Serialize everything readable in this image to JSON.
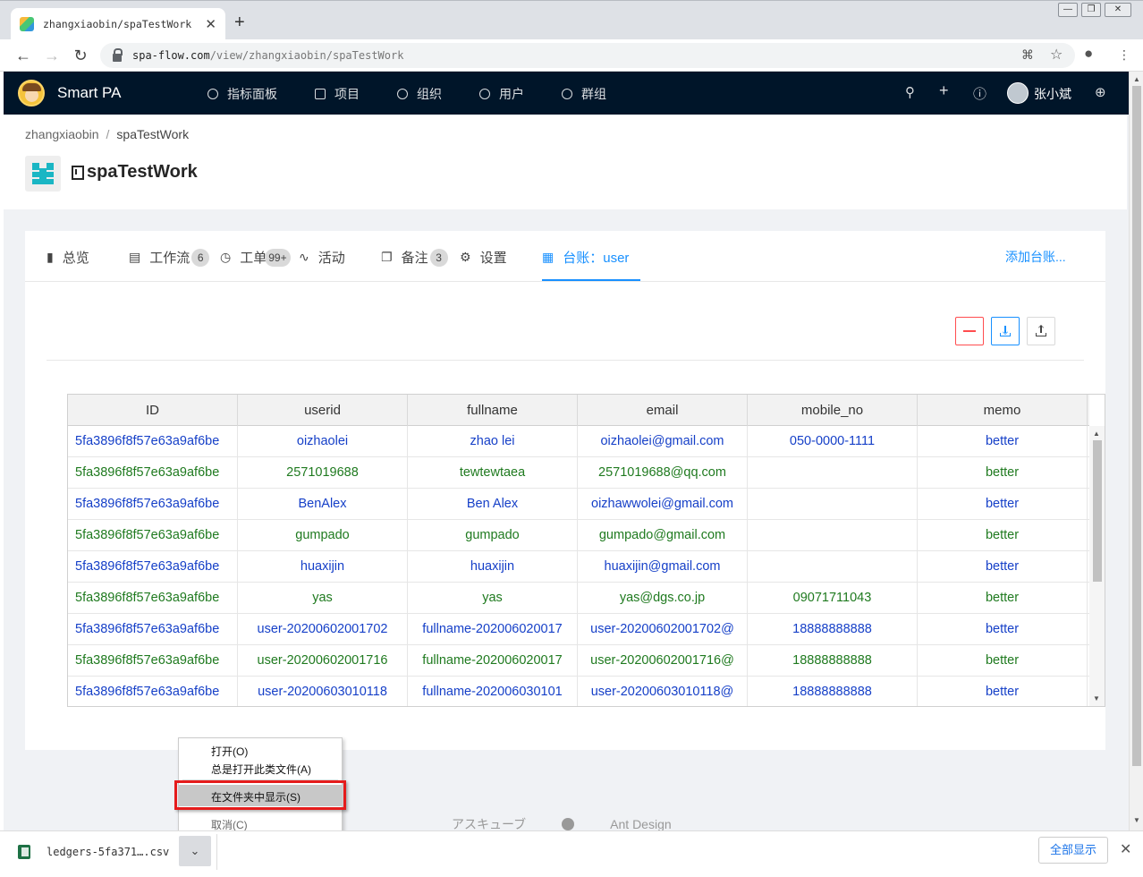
{
  "browser": {
    "tab_title": "zhangxiaobin/spaTestWork",
    "url_host": "spa-flow.com",
    "url_path": "/view/zhangxiaobin/spaTestWork"
  },
  "app": {
    "brand": "Smart PA",
    "menu": [
      "指标面板",
      "项目",
      "组织",
      "用户",
      "群组"
    ],
    "user_name": "张小斌"
  },
  "page": {
    "breadcrumb_owner": "zhangxiaobin",
    "breadcrumb_sep": "/",
    "breadcrumb_project": "spaTestWork",
    "project_title": "spaTestWork"
  },
  "tabs": {
    "overview": "总览",
    "workflow": "工作流",
    "workflow_count": "6",
    "ticket": "工单",
    "ticket_count": "99+",
    "activity": "活动",
    "notes": "备注",
    "notes_count": "3",
    "settings": "设置",
    "ledger": "台账：user",
    "add_ledger": "添加台账..."
  },
  "table": {
    "columns": [
      "ID",
      "userid",
      "fullname",
      "email",
      "mobile_no",
      "memo"
    ],
    "rows": [
      [
        "5fa3896f8f57e63a9af6be",
        "oizhaolei",
        "zhao lei",
        "oizhaolei@gmail.com",
        "050-0000-1111",
        "better"
      ],
      [
        "5fa3896f8f57e63a9af6be",
        "2571019688",
        "tewtewtaea",
        "2571019688@qq.com",
        "",
        "better"
      ],
      [
        "5fa3896f8f57e63a9af6be",
        "BenAlex",
        "Ben Alex",
        "oizhawwolei@gmail.com",
        "",
        "better"
      ],
      [
        "5fa3896f8f57e63a9af6be",
        "gumpado",
        "gumpado",
        "gumpado@gmail.com",
        "",
        "better"
      ],
      [
        "5fa3896f8f57e63a9af6be",
        "huaxijin",
        "huaxijin",
        "huaxijin@gmail.com",
        "",
        "better"
      ],
      [
        "5fa3896f8f57e63a9af6be",
        "yas",
        "yas",
        "yas@dgs.co.jp",
        "09071711043",
        "better"
      ],
      [
        "5fa3896f8f57e63a9af6be",
        "user-20200602001702",
        "fullname-202006020017",
        "user-20200602001702@",
        "18888888888",
        "better"
      ],
      [
        "5fa3896f8f57e63a9af6be",
        "user-20200602001716",
        "fullname-202006020017",
        "user-20200602001716@",
        "18888888888",
        "better"
      ],
      [
        "5fa3896f8f57e63a9af6be",
        "user-20200603010118",
        "fullname-202006030101",
        "user-20200603010118@",
        "18888888888",
        "better"
      ]
    ]
  },
  "context_menu": {
    "open": "打开(O)",
    "always_open": "总是打开此类文件(A)",
    "show_in_folder": "在文件夹中显示(S)",
    "cancel": "取消(C)"
  },
  "footer": {
    "left": "アスキューブ",
    "right": "Ant Design"
  },
  "downloads": {
    "file_name": "ledgers-5fa371….csv",
    "show_all": "全部显示"
  },
  "colors": {
    "header_bg": "#001529",
    "accent": "#1890ff",
    "row_blue": "#1640c8",
    "row_green": "#1f7a1f",
    "highlight_box": "#e51c1c"
  }
}
